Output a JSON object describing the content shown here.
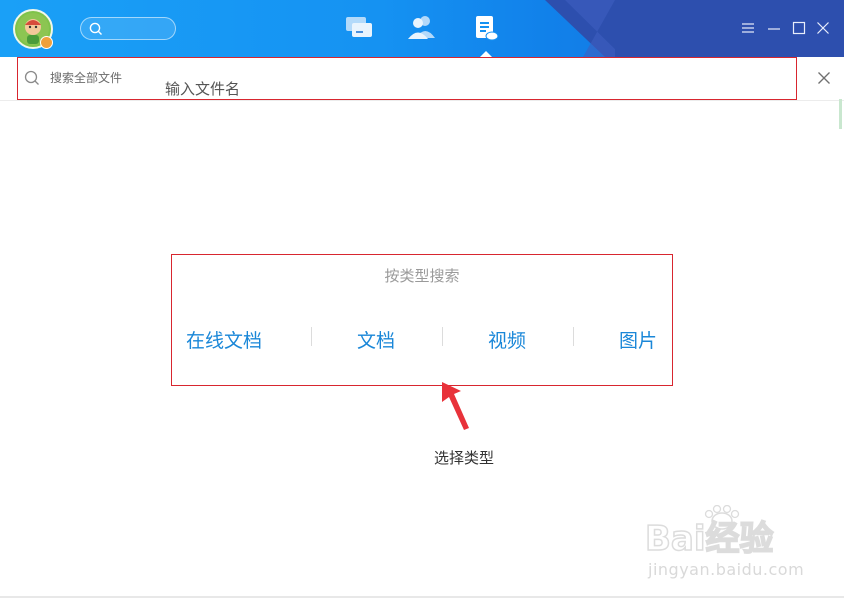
{
  "titlebar": {
    "nav": [
      "chat-icon",
      "contacts-icon",
      "files-icon"
    ],
    "active_nav": "files-icon",
    "window_controls": [
      "menu-icon",
      "minimize-icon",
      "maximize-icon",
      "close-icon"
    ],
    "colors": {
      "primary": "#1592f2",
      "dark": "#2d4fae"
    }
  },
  "search": {
    "placeholder": "搜索全部文件",
    "value": ""
  },
  "annotations": {
    "filename_hint": "输入文件名",
    "choose_type": "选择类型",
    "highlight_color": "#d8262f"
  },
  "type_search": {
    "title": "按类型搜索",
    "items": [
      {
        "label": "在线文档"
      },
      {
        "label": "文档"
      },
      {
        "label": "视频"
      },
      {
        "label": "图片"
      }
    ],
    "accent_color": "#1a87d8"
  },
  "watermark": {
    "text": "Bai经验",
    "url": "jingyan.baidu.com"
  }
}
